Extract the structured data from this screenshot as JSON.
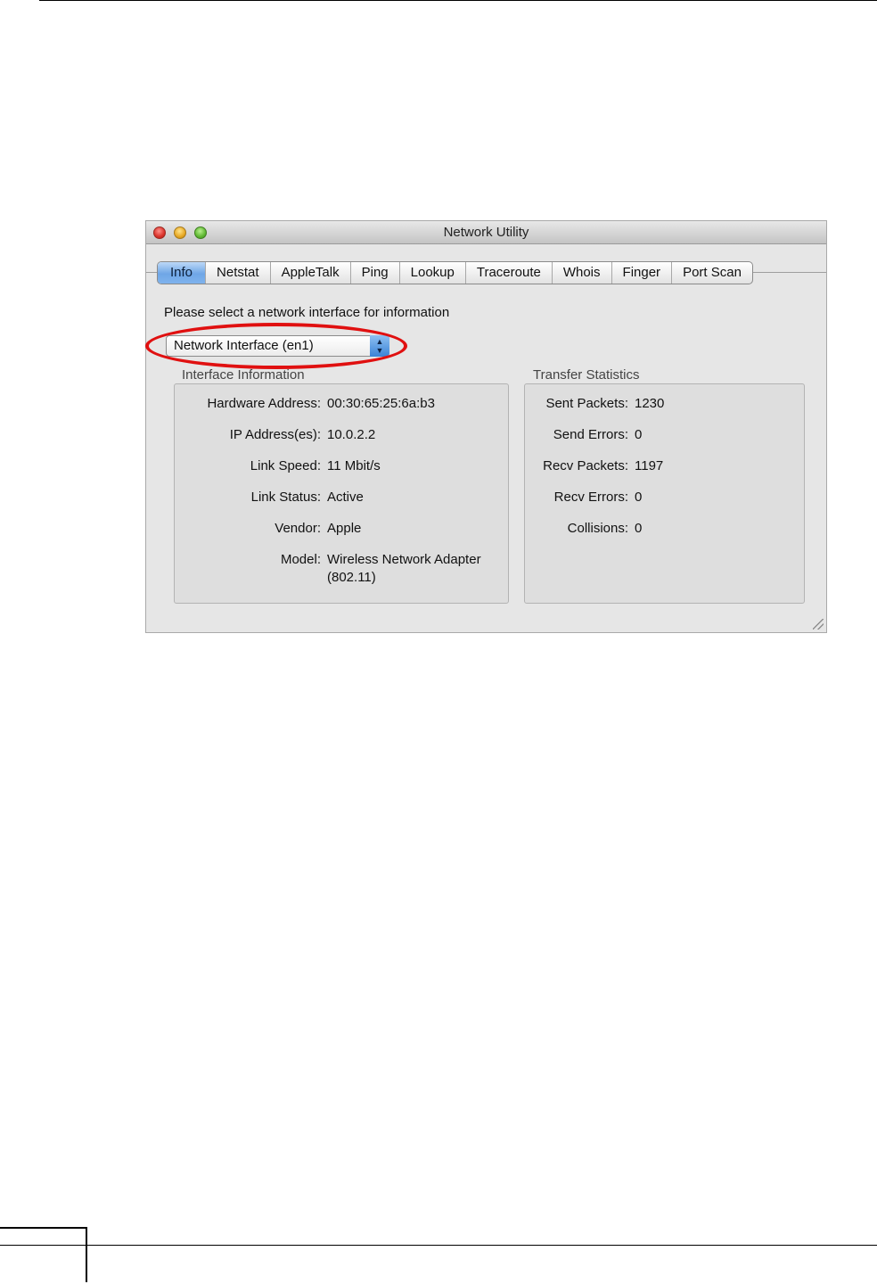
{
  "window": {
    "title": "Network Utility",
    "tabs": [
      "Info",
      "Netstat",
      "AppleTalk",
      "Ping",
      "Lookup",
      "Traceroute",
      "Whois",
      "Finger",
      "Port Scan"
    ],
    "active_tab": "Info",
    "prompt": "Please select a network interface for information",
    "interface_select": {
      "value": "Network Interface (en1)"
    },
    "interface_info": {
      "title": "Interface Information",
      "rows": [
        {
          "label": "Hardware Address:",
          "value": "00:30:65:25:6a:b3"
        },
        {
          "label": "IP Address(es):",
          "value": "10.0.2.2"
        },
        {
          "label": "Link Speed:",
          "value": "11 Mbit/s"
        },
        {
          "label": "Link Status:",
          "value": "Active"
        },
        {
          "label": "Vendor:",
          "value": "Apple"
        },
        {
          "label": "Model:",
          "value": "Wireless Network Adapter",
          "value2": "(802.11)"
        }
      ]
    },
    "transfer_stats": {
      "title": "Transfer Statistics",
      "rows": [
        {
          "label": "Sent Packets:",
          "value": "1230"
        },
        {
          "label": "Send Errors:",
          "value": "0"
        },
        {
          "label": "Recv Packets:",
          "value": "1197"
        },
        {
          "label": "Recv Errors:",
          "value": "0"
        },
        {
          "label": "Collisions:",
          "value": "0"
        }
      ]
    }
  },
  "annotation": {
    "highlight_color": "#e01010"
  }
}
